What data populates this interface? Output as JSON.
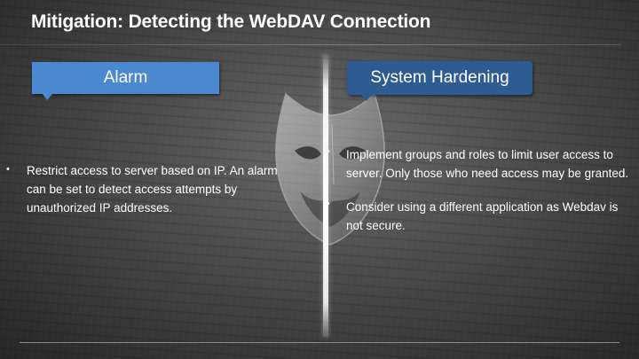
{
  "slide": {
    "title": "Mitigation: Detecting the WebDAV Connection",
    "background_art": "anonymous-mask-icon"
  },
  "left_panel": {
    "heading": "Alarm",
    "color": "#4a88cf",
    "bullets": [
      "Restrict access to server based on IP. An alarm can be set to detect access attempts by unauthorized IP addresses."
    ]
  },
  "right_panel": {
    "heading": "System Hardening",
    "color": "#2f5b93",
    "bullets": [
      "Implement groups and roles to limit user access to server. Only those who need access may be granted.",
      "Consider using a different application as Webdav is not secure."
    ]
  },
  "bullet_glyph": "•"
}
